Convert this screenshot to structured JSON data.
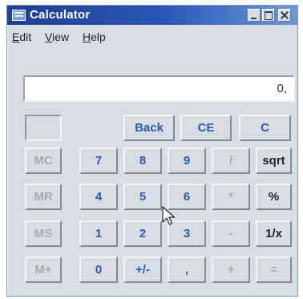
{
  "window": {
    "title": "Calculator"
  },
  "menu": {
    "edit": "Edit",
    "view": "View",
    "help": "Help"
  },
  "display": {
    "value": "0,"
  },
  "keys": {
    "back": "Back",
    "ce": "CE",
    "c": "C",
    "mc": "MC",
    "mr": "MR",
    "ms": "MS",
    "mplus": "M+",
    "n7": "7",
    "n8": "8",
    "n9": "9",
    "n4": "4",
    "n5": "5",
    "n6": "6",
    "n1": "1",
    "n2": "2",
    "n3": "3",
    "n0": "0",
    "plusminus": "+/-",
    "decimal": ",",
    "divide": "/",
    "multiply": "*",
    "subtract": "-",
    "add": "+",
    "sqrt": "sqrt",
    "percent": "%",
    "reciprocal": "1/x",
    "equals": "="
  },
  "colors": {
    "title_gradient_start": "#1f3f8e",
    "title_gradient_end": "#6f98d8",
    "key_blue": "#2c5aa8",
    "key_red": "#c43a3a",
    "disabled": "#a2acb8"
  }
}
